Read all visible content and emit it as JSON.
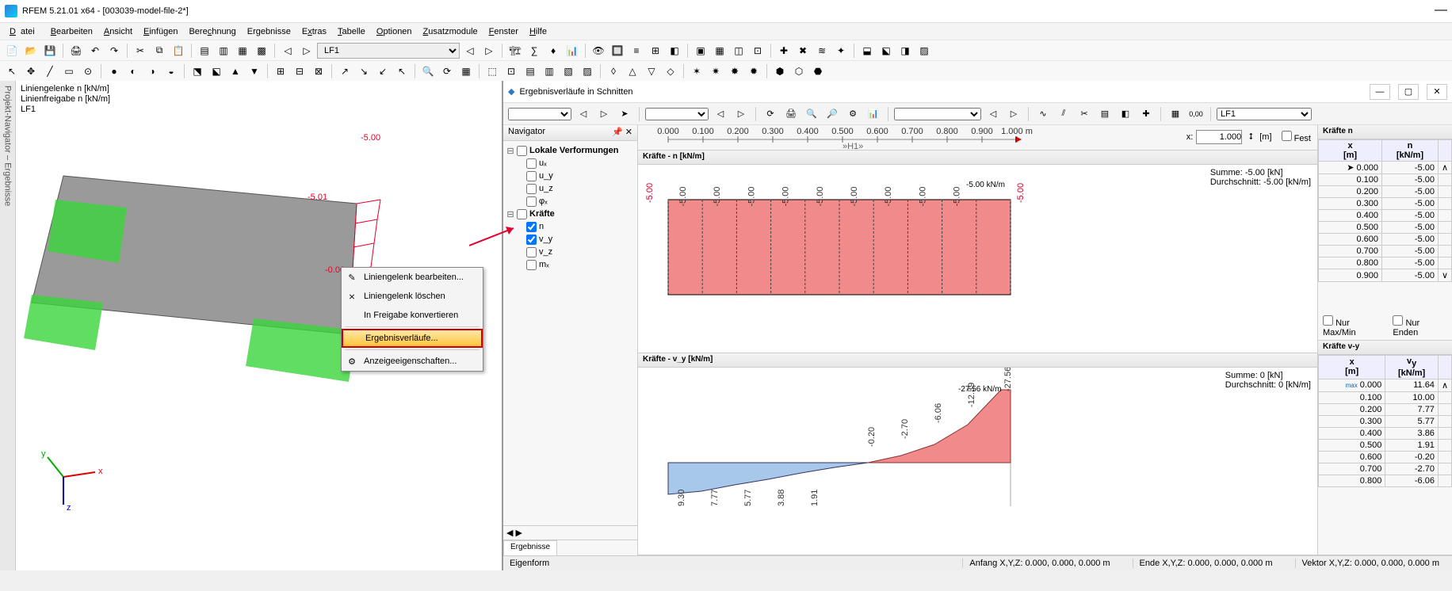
{
  "app": {
    "title": "RFEM 5.21.01 x64 - [003039-model-file-2*]"
  },
  "menubar": [
    "Datei",
    "Bearbeiten",
    "Ansicht",
    "Einfügen",
    "Berechnung",
    "Ergebnisse",
    "Extras",
    "Tabelle",
    "Optionen",
    "Zusatzmodule",
    "Fenster",
    "Hilfe"
  ],
  "toolbar_lf": "LF1",
  "legend": {
    "l1": "Liniengelenke n [kN/m]",
    "l2": "Linienfreigabe n [kN/m]",
    "l3": "LF1"
  },
  "scene_labels": {
    "top": "-5.00",
    "mid": "-5.01",
    "bot": "-0.00"
  },
  "sidebar_tab": "Projekt-Navigator – Ergebnisse",
  "ctx": {
    "edit": "Liniengelenk bearbeiten...",
    "del": "Liniengelenk löschen",
    "conv": "In Freigabe konvertieren",
    "res": "Ergebnisverläufe...",
    "disp": "Anzeigeeigenschaften..."
  },
  "resultwin": {
    "title": "Ergebnisverläufe in Schnitten",
    "lf": "LF1",
    "x_value": "1.000",
    "x_unit": "[m]",
    "fest": "Fest"
  },
  "navigator": {
    "title": "Navigator",
    "group1": "Lokale Verformungen",
    "items1": [
      "uₓ",
      "u_y",
      "u_z",
      "φₓ"
    ],
    "group2": "Kräfte",
    "items2": [
      "n",
      "v_y",
      "v_z",
      "mₓ"
    ],
    "tab": "Ergebnisse"
  },
  "ruler_ticks": [
    "0.000",
    "0.100",
    "0.200",
    "0.300",
    "0.400",
    "0.500",
    "0.600",
    "0.700",
    "0.800",
    "0.900",
    "1.000 m"
  ],
  "ruler_mid": "»H1»",
  "plot_n": {
    "title": "Kräfte - n [kN/m]",
    "sum": "Summe: -5.00 [kN]",
    "avg": "Durchschnitt: -5.00 [kN/m]",
    "peak_label": "-5.00 kN/m",
    "side": "-5.00",
    "bar_labels": [
      "-5.00",
      "-5.00",
      "-5.00",
      "-5.00",
      "-5.00",
      "-5.00",
      "-5.00",
      "-5.00",
      "-5.00"
    ]
  },
  "plot_vy": {
    "title": "Kräfte - v_y [kN/m]",
    "sum": "Summe: 0 [kN]",
    "avg": "Durchschnitt: 0 [kN/m]",
    "peak_label": "-27.56 kN/m",
    "labels": [
      "9.30",
      "7.77",
      "5.77",
      "3.88",
      "1.91",
      "-0.20",
      "-2.70",
      "-6.06",
      "-12.39",
      "-27.56"
    ]
  },
  "table_n": {
    "title": "Kräfte n",
    "h1": "x\n[m]",
    "h2": "n\n[kN/m]",
    "rows": [
      [
        "0.000",
        "-5.00"
      ],
      [
        "0.100",
        "-5.00"
      ],
      [
        "0.200",
        "-5.00"
      ],
      [
        "0.300",
        "-5.00"
      ],
      [
        "0.400",
        "-5.00"
      ],
      [
        "0.500",
        "-5.00"
      ],
      [
        "0.600",
        "-5.00"
      ],
      [
        "0.700",
        "-5.00"
      ],
      [
        "0.800",
        "-5.00"
      ],
      [
        "0.900",
        "-5.00"
      ]
    ],
    "chk1": "Nur Max/Min",
    "chk2": "Nur Enden"
  },
  "table_vy": {
    "title": "Kräfte v-y",
    "h1": "x\n[m]",
    "h2": "v_y\n[kN/m]",
    "rows": [
      [
        "0.000",
        "11.64"
      ],
      [
        "0.100",
        "10.00"
      ],
      [
        "0.200",
        "7.77"
      ],
      [
        "0.300",
        "5.77"
      ],
      [
        "0.400",
        "3.86"
      ],
      [
        "0.500",
        "1.91"
      ],
      [
        "0.600",
        "-0.20"
      ],
      [
        "0.700",
        "-2.70"
      ],
      [
        "0.800",
        "-6.06"
      ]
    ]
  },
  "status": {
    "eigen": "Eigenform",
    "anf_lbl": "Anfang X,Y,Z:",
    "anf": "0.000, 0.000, 0.000 m",
    "end_lbl": "Ende X,Y,Z:",
    "end": "0.000, 0.000, 0.000 m",
    "vec_lbl": "Vektor X,Y,Z:",
    "vec": "0.000, 0.000, 0.000 m"
  },
  "chart_data": [
    {
      "type": "bar",
      "title": "Kräfte - n [kN/m]",
      "xlabel": "x [m]",
      "ylabel": "n [kN/m]",
      "x": [
        0.0,
        0.1,
        0.2,
        0.3,
        0.4,
        0.5,
        0.6,
        0.7,
        0.8,
        0.9,
        1.0
      ],
      "values": [
        -5.0,
        -5.0,
        -5.0,
        -5.0,
        -5.0,
        -5.0,
        -5.0,
        -5.0,
        -5.0,
        -5.0,
        -5.0
      ],
      "ylim": [
        -5.5,
        0
      ],
      "summary": {
        "sum_kN": -5.0,
        "avg_kN_per_m": -5.0
      }
    },
    {
      "type": "area",
      "title": "Kräfte - v_y [kN/m]",
      "xlabel": "x [m]",
      "ylabel": "v_y [kN/m]",
      "x": [
        0.0,
        0.1,
        0.2,
        0.3,
        0.4,
        0.5,
        0.6,
        0.7,
        0.8,
        0.9,
        1.0
      ],
      "values": [
        11.64,
        10.0,
        7.77,
        5.77,
        3.86,
        1.91,
        -0.2,
        -2.7,
        -6.06,
        -12.39,
        -27.56
      ],
      "ylim": [
        -30,
        15
      ],
      "summary": {
        "sum_kN": 0,
        "avg_kN_per_m": 0
      }
    }
  ]
}
